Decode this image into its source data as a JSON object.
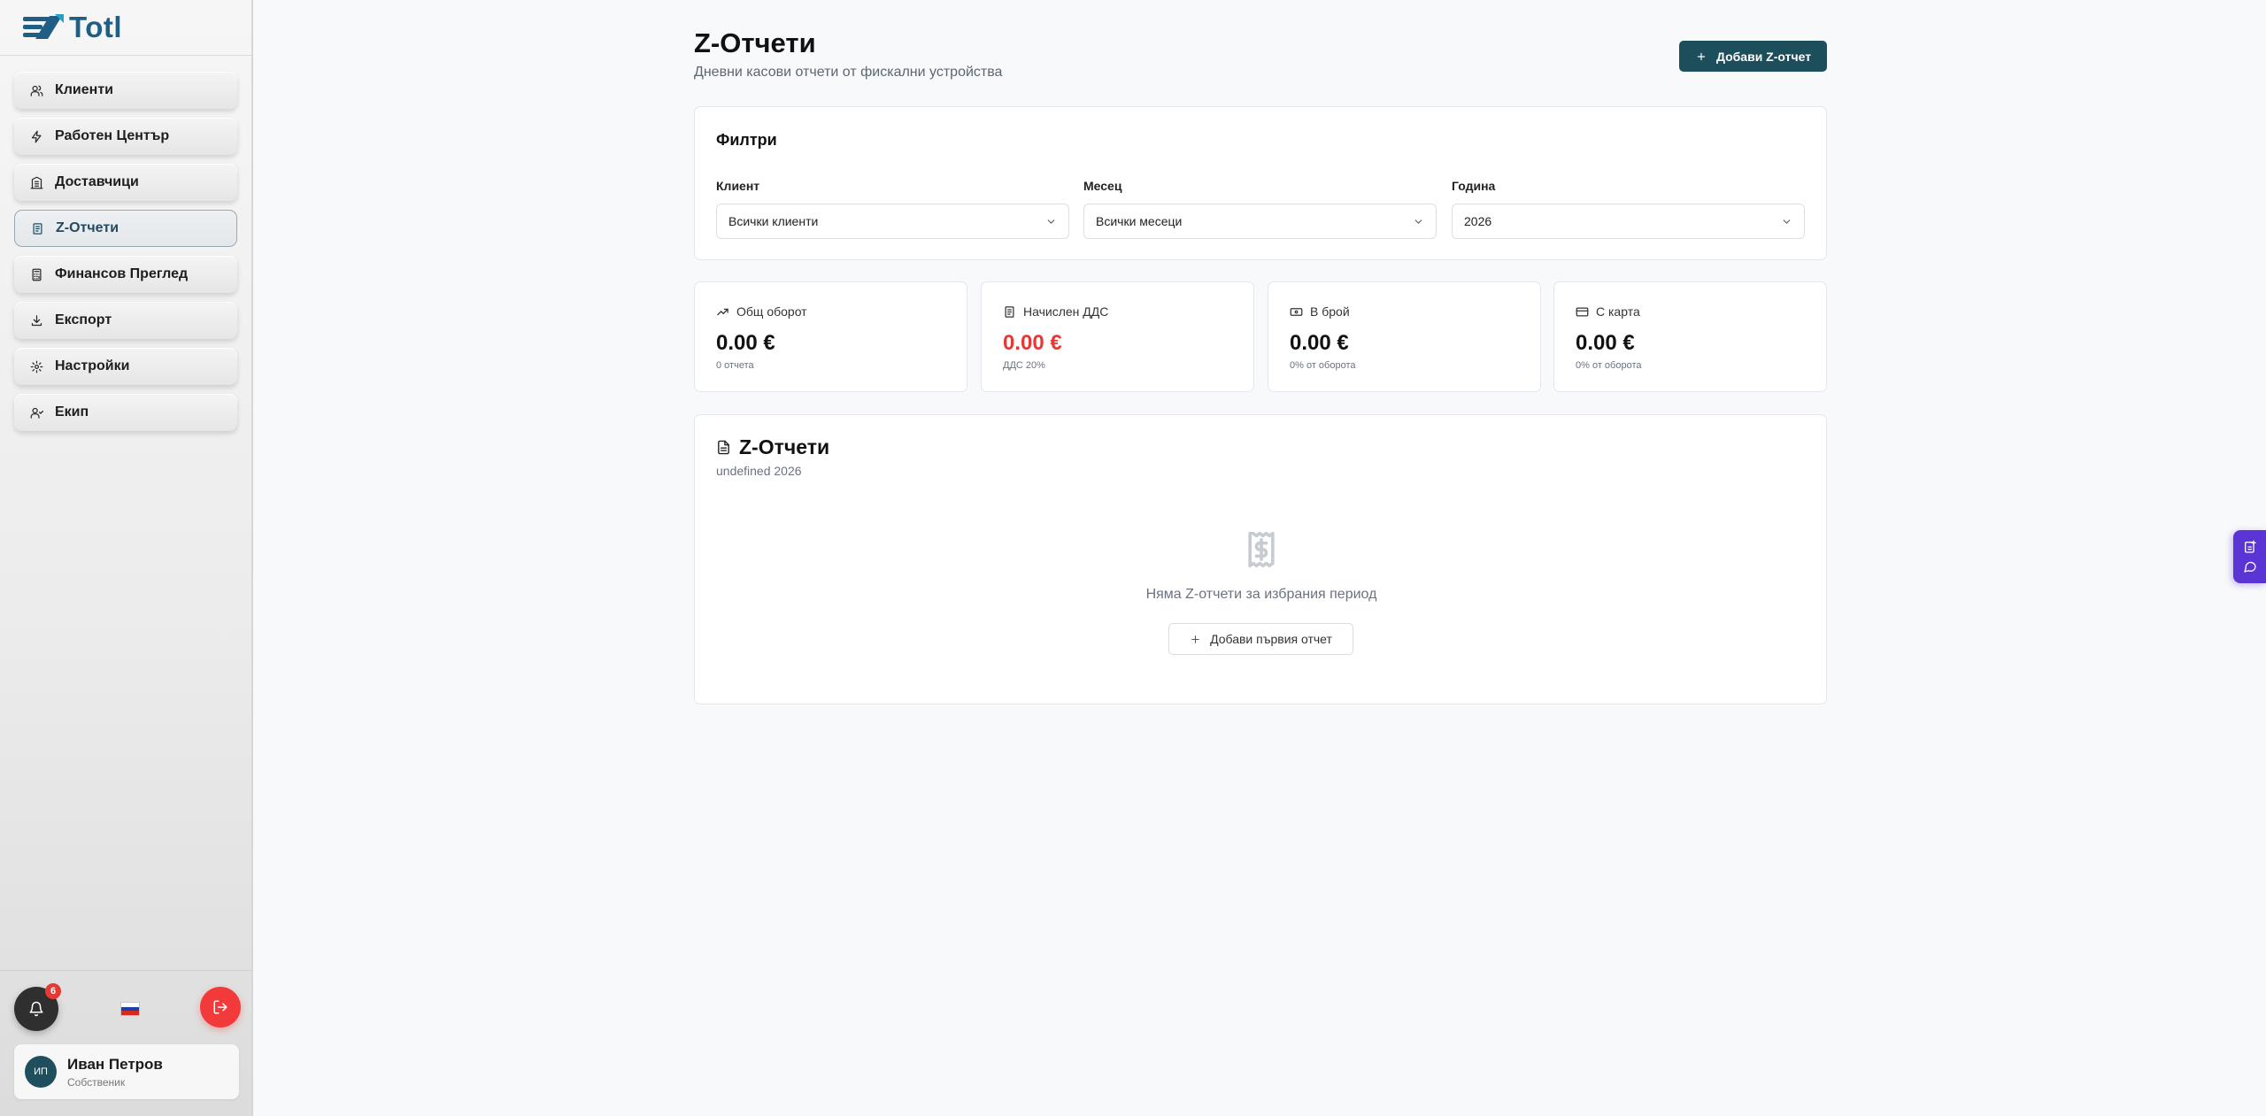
{
  "brand": {
    "name": "Totl",
    "color": "#1f5f86"
  },
  "sidebar": {
    "items": [
      {
        "label": "Клиенти",
        "icon": "users-icon"
      },
      {
        "label": "Работен Център",
        "icon": "zap-icon"
      },
      {
        "label": "Доставчици",
        "icon": "building-icon"
      },
      {
        "label": "Z-Отчети",
        "icon": "receipt-icon",
        "active": true
      },
      {
        "label": "Финансов Преглед",
        "icon": "calculator-icon"
      },
      {
        "label": "Експорт",
        "icon": "download-icon"
      },
      {
        "label": "Настройки",
        "icon": "gear-icon"
      },
      {
        "label": "Екип",
        "icon": "team-icon"
      }
    ],
    "notifications_count": "6",
    "language_flag": "ru",
    "user": {
      "initials": "ИП",
      "name": "Иван Петров",
      "role": "Собственик"
    }
  },
  "header": {
    "title": "Z-Отчети",
    "subtitle": "Дневни касови отчети от фискални устройства",
    "add_button": "Добави Z-отчет"
  },
  "filters": {
    "title": "Филтри",
    "client": {
      "label": "Клиент",
      "value": "Всички клиенти"
    },
    "month": {
      "label": "Месец",
      "value": "Всички месеци"
    },
    "year": {
      "label": "Година",
      "value": "2026"
    }
  },
  "stats": [
    {
      "label": "Общ оборот",
      "value": "0.00 €",
      "sub": "0 отчета",
      "icon": "trending-up-icon"
    },
    {
      "label": "Начислен ДДС",
      "value": "0.00 €",
      "sub": "ДДС 20%",
      "icon": "receipt-icon",
      "value_color": "#e53935"
    },
    {
      "label": "В брой",
      "value": "0.00 €",
      "sub": "0% от оборота",
      "icon": "banknote-icon"
    },
    {
      "label": "С карта",
      "value": "0.00 €",
      "sub": "0% от оборота",
      "icon": "credit-card-icon"
    }
  ],
  "reports": {
    "title": "Z-Отчети",
    "period": "undefined 2026",
    "empty_text": "Няма Z-отчети за избрания период",
    "empty_button": "Добави първия отчет"
  },
  "colors": {
    "primary": "#1d4e5c",
    "danger": "#f23a3a",
    "accent": "#5b34d6"
  }
}
